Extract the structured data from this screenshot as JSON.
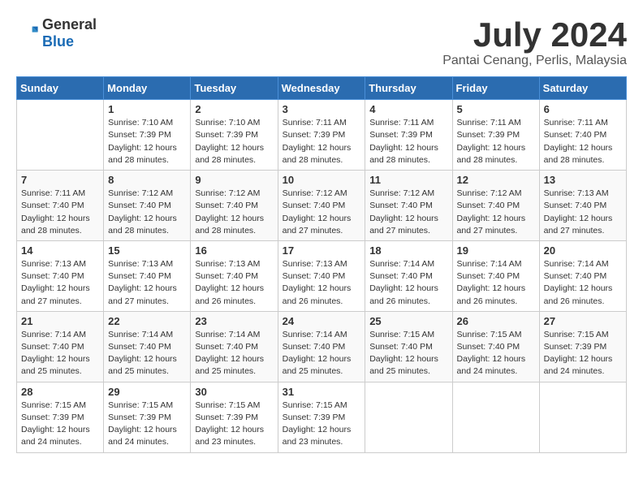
{
  "logo": {
    "general": "General",
    "blue": "Blue"
  },
  "title": {
    "month": "July 2024",
    "location": "Pantai Cenang, Perlis, Malaysia"
  },
  "days_of_week": [
    "Sunday",
    "Monday",
    "Tuesday",
    "Wednesday",
    "Thursday",
    "Friday",
    "Saturday"
  ],
  "weeks": [
    [
      {
        "day": "",
        "info": ""
      },
      {
        "day": "1",
        "info": "Sunrise: 7:10 AM\nSunset: 7:39 PM\nDaylight: 12 hours\nand 28 minutes."
      },
      {
        "day": "2",
        "info": "Sunrise: 7:10 AM\nSunset: 7:39 PM\nDaylight: 12 hours\nand 28 minutes."
      },
      {
        "day": "3",
        "info": "Sunrise: 7:11 AM\nSunset: 7:39 PM\nDaylight: 12 hours\nand 28 minutes."
      },
      {
        "day": "4",
        "info": "Sunrise: 7:11 AM\nSunset: 7:39 PM\nDaylight: 12 hours\nand 28 minutes."
      },
      {
        "day": "5",
        "info": "Sunrise: 7:11 AM\nSunset: 7:39 PM\nDaylight: 12 hours\nand 28 minutes."
      },
      {
        "day": "6",
        "info": "Sunrise: 7:11 AM\nSunset: 7:40 PM\nDaylight: 12 hours\nand 28 minutes."
      }
    ],
    [
      {
        "day": "7",
        "info": "Sunrise: 7:11 AM\nSunset: 7:40 PM\nDaylight: 12 hours\nand 28 minutes."
      },
      {
        "day": "8",
        "info": "Sunrise: 7:12 AM\nSunset: 7:40 PM\nDaylight: 12 hours\nand 28 minutes."
      },
      {
        "day": "9",
        "info": "Sunrise: 7:12 AM\nSunset: 7:40 PM\nDaylight: 12 hours\nand 28 minutes."
      },
      {
        "day": "10",
        "info": "Sunrise: 7:12 AM\nSunset: 7:40 PM\nDaylight: 12 hours\nand 27 minutes."
      },
      {
        "day": "11",
        "info": "Sunrise: 7:12 AM\nSunset: 7:40 PM\nDaylight: 12 hours\nand 27 minutes."
      },
      {
        "day": "12",
        "info": "Sunrise: 7:12 AM\nSunset: 7:40 PM\nDaylight: 12 hours\nand 27 minutes."
      },
      {
        "day": "13",
        "info": "Sunrise: 7:13 AM\nSunset: 7:40 PM\nDaylight: 12 hours\nand 27 minutes."
      }
    ],
    [
      {
        "day": "14",
        "info": "Sunrise: 7:13 AM\nSunset: 7:40 PM\nDaylight: 12 hours\nand 27 minutes."
      },
      {
        "day": "15",
        "info": "Sunrise: 7:13 AM\nSunset: 7:40 PM\nDaylight: 12 hours\nand 27 minutes."
      },
      {
        "day": "16",
        "info": "Sunrise: 7:13 AM\nSunset: 7:40 PM\nDaylight: 12 hours\nand 26 minutes."
      },
      {
        "day": "17",
        "info": "Sunrise: 7:13 AM\nSunset: 7:40 PM\nDaylight: 12 hours\nand 26 minutes."
      },
      {
        "day": "18",
        "info": "Sunrise: 7:14 AM\nSunset: 7:40 PM\nDaylight: 12 hours\nand 26 minutes."
      },
      {
        "day": "19",
        "info": "Sunrise: 7:14 AM\nSunset: 7:40 PM\nDaylight: 12 hours\nand 26 minutes."
      },
      {
        "day": "20",
        "info": "Sunrise: 7:14 AM\nSunset: 7:40 PM\nDaylight: 12 hours\nand 26 minutes."
      }
    ],
    [
      {
        "day": "21",
        "info": "Sunrise: 7:14 AM\nSunset: 7:40 PM\nDaylight: 12 hours\nand 25 minutes."
      },
      {
        "day": "22",
        "info": "Sunrise: 7:14 AM\nSunset: 7:40 PM\nDaylight: 12 hours\nand 25 minutes."
      },
      {
        "day": "23",
        "info": "Sunrise: 7:14 AM\nSunset: 7:40 PM\nDaylight: 12 hours\nand 25 minutes."
      },
      {
        "day": "24",
        "info": "Sunrise: 7:14 AM\nSunset: 7:40 PM\nDaylight: 12 hours\nand 25 minutes."
      },
      {
        "day": "25",
        "info": "Sunrise: 7:15 AM\nSunset: 7:40 PM\nDaylight: 12 hours\nand 25 minutes."
      },
      {
        "day": "26",
        "info": "Sunrise: 7:15 AM\nSunset: 7:40 PM\nDaylight: 12 hours\nand 24 minutes."
      },
      {
        "day": "27",
        "info": "Sunrise: 7:15 AM\nSunset: 7:39 PM\nDaylight: 12 hours\nand 24 minutes."
      }
    ],
    [
      {
        "day": "28",
        "info": "Sunrise: 7:15 AM\nSunset: 7:39 PM\nDaylight: 12 hours\nand 24 minutes."
      },
      {
        "day": "29",
        "info": "Sunrise: 7:15 AM\nSunset: 7:39 PM\nDaylight: 12 hours\nand 24 minutes."
      },
      {
        "day": "30",
        "info": "Sunrise: 7:15 AM\nSunset: 7:39 PM\nDaylight: 12 hours\nand 23 minutes."
      },
      {
        "day": "31",
        "info": "Sunrise: 7:15 AM\nSunset: 7:39 PM\nDaylight: 12 hours\nand 23 minutes."
      },
      {
        "day": "",
        "info": ""
      },
      {
        "day": "",
        "info": ""
      },
      {
        "day": "",
        "info": ""
      }
    ]
  ]
}
